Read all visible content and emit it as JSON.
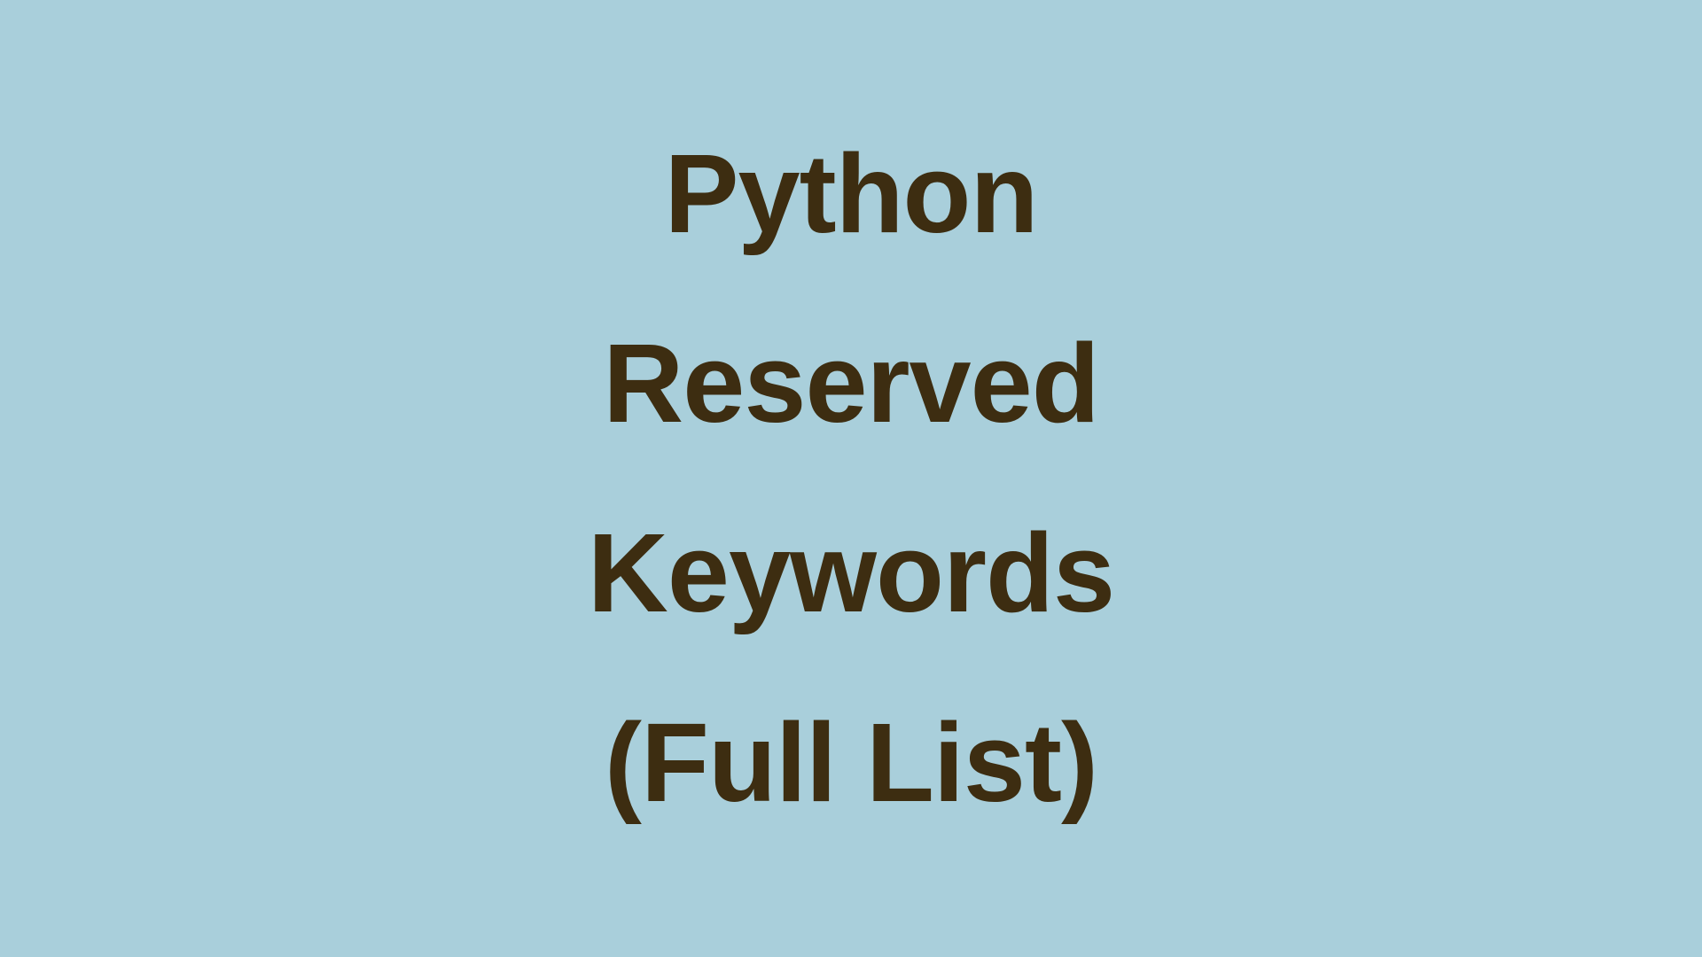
{
  "title": {
    "line1": "Python",
    "line2": "Reserved",
    "line3": "Keywords",
    "line4": "(Full List)"
  },
  "colors": {
    "background": "#a9cfdb",
    "text": "#3d2d11"
  }
}
